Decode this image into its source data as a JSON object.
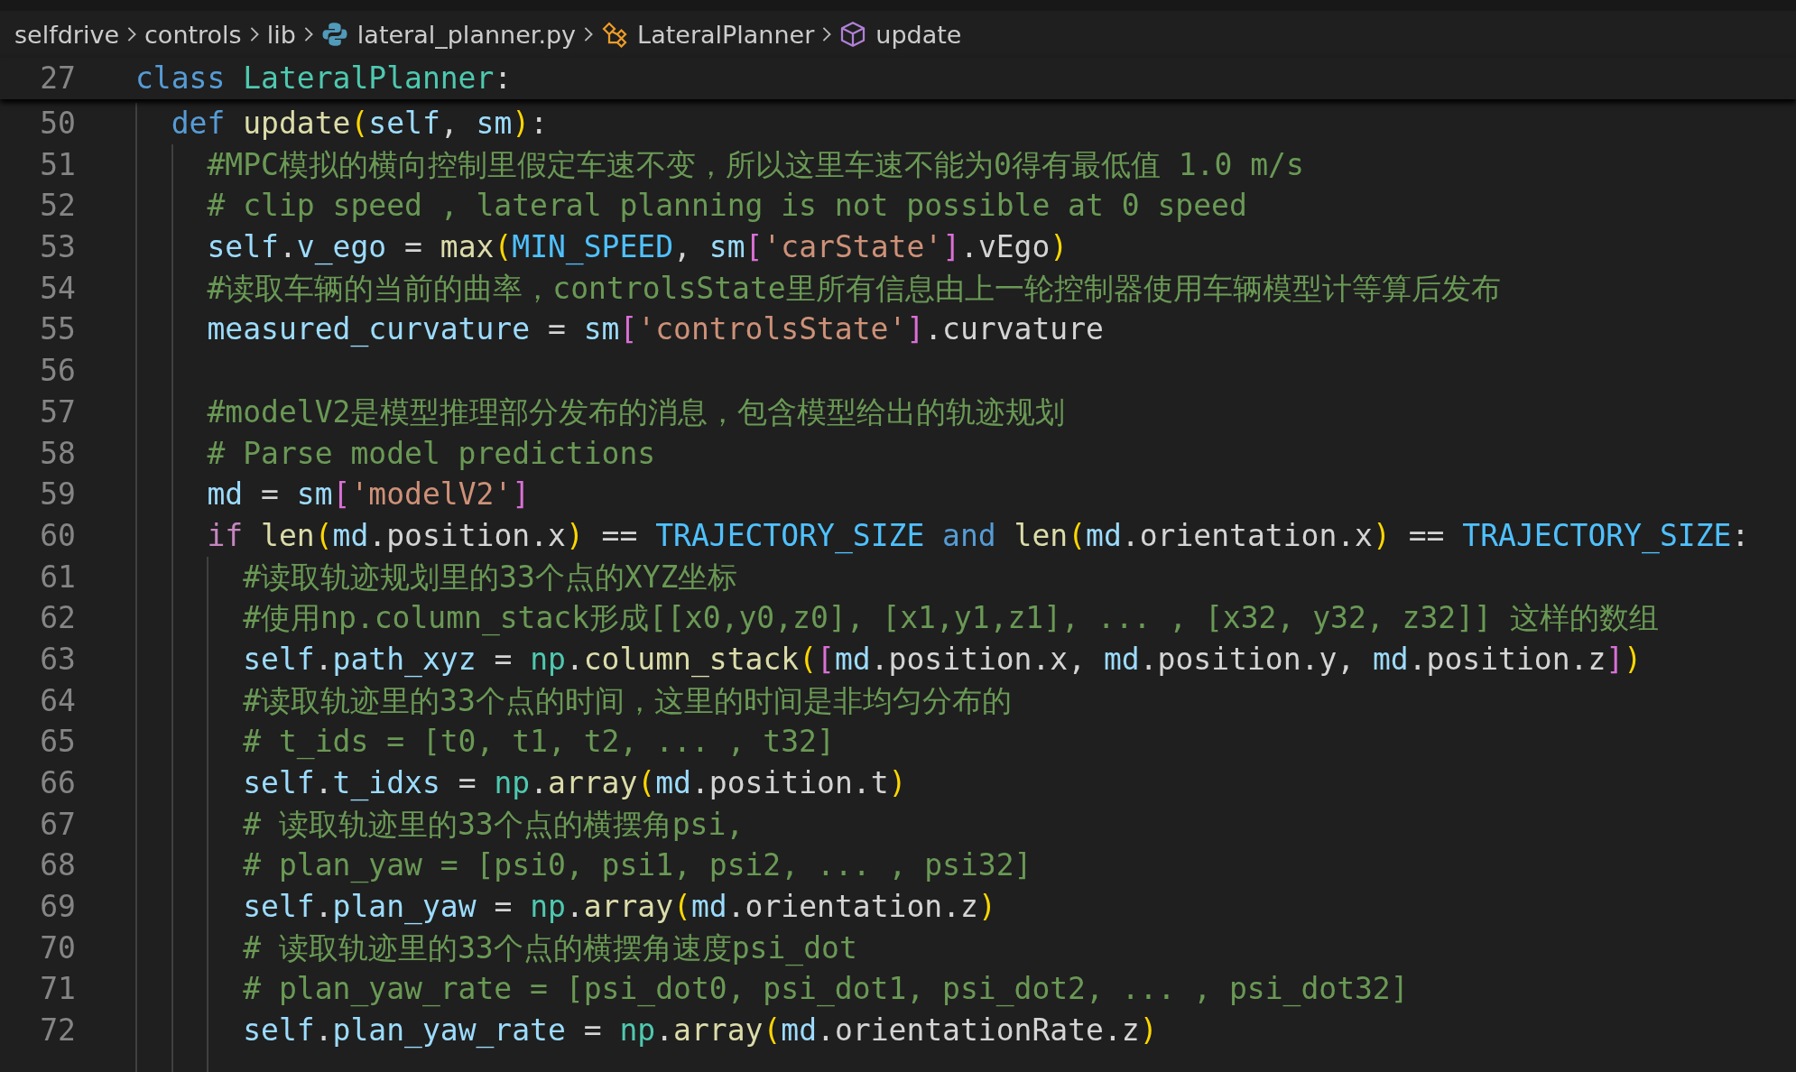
{
  "breadcrumbs": [
    {
      "label": "selfdrive",
      "kind": "folder"
    },
    {
      "label": "controls",
      "kind": "folder"
    },
    {
      "label": "lib",
      "kind": "folder"
    },
    {
      "label": "lateral_planner.py",
      "kind": "python-file"
    },
    {
      "label": "LateralPlanner",
      "kind": "class"
    },
    {
      "label": "update",
      "kind": "method"
    }
  ],
  "sticky_line": {
    "num": "27",
    "tokens": [
      {
        "text": "class",
        "kind": "kw"
      },
      {
        "text": " LateralPlanner",
        "kind": "cls"
      },
      {
        "text": ":",
        "kind": "p"
      }
    ]
  },
  "lines": [
    {
      "num": "50",
      "tokens": [
        {
          "text": "  def",
          "kind": "kw"
        },
        {
          "text": " update",
          "kind": "fn"
        },
        {
          "text": "(",
          "kind": "b1"
        },
        {
          "text": "self",
          "kind": "var"
        },
        {
          "text": ", ",
          "kind": "p"
        },
        {
          "text": "sm",
          "kind": "var"
        },
        {
          "text": ")",
          "kind": "b1"
        },
        {
          "text": ":",
          "kind": "p"
        }
      ]
    },
    {
      "num": "51",
      "tokens": [
        {
          "text": "    #MPC模拟的横向控制里假定车速不变，所以这里车速不能为0得有最低值 1.0 m/s",
          "kind": "cm"
        }
      ]
    },
    {
      "num": "52",
      "tokens": [
        {
          "text": "    # clip speed , lateral planning is not possible at 0 speed",
          "kind": "cm"
        }
      ]
    },
    {
      "num": "53",
      "tokens": [
        {
          "text": "    self",
          "kind": "var"
        },
        {
          "text": ".",
          "kind": "p"
        },
        {
          "text": "v_ego",
          "kind": "var"
        },
        {
          "text": " = ",
          "kind": "p"
        },
        {
          "text": "max",
          "kind": "fn"
        },
        {
          "text": "(",
          "kind": "b1"
        },
        {
          "text": "MIN_SPEED",
          "kind": "const"
        },
        {
          "text": ", ",
          "kind": "p"
        },
        {
          "text": "sm",
          "kind": "var"
        },
        {
          "text": "[",
          "kind": "b2"
        },
        {
          "text": "'carState'",
          "kind": "str"
        },
        {
          "text": "]",
          "kind": "b2"
        },
        {
          "text": ".vEgo",
          "kind": "p"
        },
        {
          "text": ")",
          "kind": "b1"
        }
      ]
    },
    {
      "num": "54",
      "tokens": [
        {
          "text": "    #读取车辆的当前的曲率，controlsState里所有信息由上一轮控制器使用车辆模型计等算后发布",
          "kind": "cm"
        }
      ]
    },
    {
      "num": "55",
      "tokens": [
        {
          "text": "    measured_curvature",
          "kind": "var"
        },
        {
          "text": " = ",
          "kind": "p"
        },
        {
          "text": "sm",
          "kind": "var"
        },
        {
          "text": "[",
          "kind": "b2"
        },
        {
          "text": "'controlsState'",
          "kind": "str"
        },
        {
          "text": "]",
          "kind": "b2"
        },
        {
          "text": ".curvature",
          "kind": "p"
        }
      ]
    },
    {
      "num": "56"
    },
    {
      "num": "57",
      "tokens": [
        {
          "text": "    #modelV2是模型推理部分发布的消息，包含模型给出的轨迹规划",
          "kind": "cm"
        }
      ]
    },
    {
      "num": "58",
      "tokens": [
        {
          "text": "    # Parse model predictions",
          "kind": "cm"
        }
      ]
    },
    {
      "num": "59",
      "tokens": [
        {
          "text": "    md",
          "kind": "var"
        },
        {
          "text": " = ",
          "kind": "p"
        },
        {
          "text": "sm",
          "kind": "var"
        },
        {
          "text": "[",
          "kind": "b2"
        },
        {
          "text": "'modelV2'",
          "kind": "str"
        },
        {
          "text": "]",
          "kind": "b2"
        }
      ]
    },
    {
      "num": "60",
      "tokens": [
        {
          "text": "    if",
          "kind": "kw2"
        },
        {
          "text": " len",
          "kind": "fn"
        },
        {
          "text": "(",
          "kind": "b1"
        },
        {
          "text": "md",
          "kind": "var"
        },
        {
          "text": ".position.x",
          "kind": "p"
        },
        {
          "text": ")",
          "kind": "b1"
        },
        {
          "text": " == ",
          "kind": "p"
        },
        {
          "text": "TRAJECTORY_SIZE",
          "kind": "const"
        },
        {
          "text": " and",
          "kind": "kw"
        },
        {
          "text": " len",
          "kind": "fn"
        },
        {
          "text": "(",
          "kind": "b1"
        },
        {
          "text": "md",
          "kind": "var"
        },
        {
          "text": ".orientation.x",
          "kind": "p"
        },
        {
          "text": ")",
          "kind": "b1"
        },
        {
          "text": " == ",
          "kind": "p"
        },
        {
          "text": "TRAJECTORY_SIZE",
          "kind": "const"
        },
        {
          "text": ":",
          "kind": "p"
        }
      ]
    },
    {
      "num": "61",
      "tokens": [
        {
          "text": "      #读取轨迹规划里的33个点的XYZ坐标",
          "kind": "cm"
        }
      ]
    },
    {
      "num": "62",
      "tokens": [
        {
          "text": "      #使用np.column_stack形成[[x0,y0,z0], [x1,y1,z1], ... , [x32, y32, z32]] 这样的数组",
          "kind": "cm"
        }
      ]
    },
    {
      "num": "63",
      "tokens": [
        {
          "text": "      self",
          "kind": "var"
        },
        {
          "text": ".",
          "kind": "p"
        },
        {
          "text": "path_xyz",
          "kind": "var"
        },
        {
          "text": " = ",
          "kind": "p"
        },
        {
          "text": "np",
          "kind": "cls"
        },
        {
          "text": ".",
          "kind": "p"
        },
        {
          "text": "column_stack",
          "kind": "fn"
        },
        {
          "text": "(",
          "kind": "b1"
        },
        {
          "text": "[",
          "kind": "b2"
        },
        {
          "text": "md",
          "kind": "var"
        },
        {
          "text": ".position.x, ",
          "kind": "p"
        },
        {
          "text": "md",
          "kind": "var"
        },
        {
          "text": ".position.y, ",
          "kind": "p"
        },
        {
          "text": "md",
          "kind": "var"
        },
        {
          "text": ".position.z",
          "kind": "p"
        },
        {
          "text": "]",
          "kind": "b2"
        },
        {
          "text": ")",
          "kind": "b1"
        }
      ]
    },
    {
      "num": "64",
      "tokens": [
        {
          "text": "      #读取轨迹里的33个点的时间，这里的时间是非均匀分布的",
          "kind": "cm"
        }
      ]
    },
    {
      "num": "65",
      "tokens": [
        {
          "text": "      # t_ids = [t0, t1, t2, ... , t32]",
          "kind": "cm"
        }
      ]
    },
    {
      "num": "66",
      "tokens": [
        {
          "text": "      self",
          "kind": "var"
        },
        {
          "text": ".",
          "kind": "p"
        },
        {
          "text": "t_idxs",
          "kind": "var"
        },
        {
          "text": " = ",
          "kind": "p"
        },
        {
          "text": "np",
          "kind": "cls"
        },
        {
          "text": ".",
          "kind": "p"
        },
        {
          "text": "array",
          "kind": "fn"
        },
        {
          "text": "(",
          "kind": "b1"
        },
        {
          "text": "md",
          "kind": "var"
        },
        {
          "text": ".position.t",
          "kind": "p"
        },
        {
          "text": ")",
          "kind": "b1"
        }
      ]
    },
    {
      "num": "67",
      "tokens": [
        {
          "text": "      # 读取轨迹里的33个点的横摆角psi,",
          "kind": "cm"
        }
      ]
    },
    {
      "num": "68",
      "tokens": [
        {
          "text": "      # plan_yaw = [psi0, psi1, psi2, ... , psi32]",
          "kind": "cm"
        }
      ]
    },
    {
      "num": "69",
      "tokens": [
        {
          "text": "      self",
          "kind": "var"
        },
        {
          "text": ".",
          "kind": "p"
        },
        {
          "text": "plan_yaw",
          "kind": "var"
        },
        {
          "text": " = ",
          "kind": "p"
        },
        {
          "text": "np",
          "kind": "cls"
        },
        {
          "text": ".",
          "kind": "p"
        },
        {
          "text": "array",
          "kind": "fn"
        },
        {
          "text": "(",
          "kind": "b1"
        },
        {
          "text": "md",
          "kind": "var"
        },
        {
          "text": ".orientation.z",
          "kind": "p"
        },
        {
          "text": ")",
          "kind": "b1"
        }
      ]
    },
    {
      "num": "70",
      "tokens": [
        {
          "text": "      # 读取轨迹里的33个点的横摆角速度psi_dot",
          "kind": "cm"
        }
      ]
    },
    {
      "num": "71",
      "tokens": [
        {
          "text": "      # plan_yaw_rate = [psi_dot0, psi_dot1, psi_dot2, ... , psi_dot32]",
          "kind": "cm"
        }
      ]
    },
    {
      "num": "72",
      "tokens": [
        {
          "text": "      self",
          "kind": "var"
        },
        {
          "text": ".",
          "kind": "p"
        },
        {
          "text": "plan_yaw_rate",
          "kind": "var"
        },
        {
          "text": " = ",
          "kind": "p"
        },
        {
          "text": "np",
          "kind": "cls"
        },
        {
          "text": ".",
          "kind": "p"
        },
        {
          "text": "array",
          "kind": "fn"
        },
        {
          "text": "(",
          "kind": "b1"
        },
        {
          "text": "md",
          "kind": "var"
        },
        {
          "text": ".orientationRate.z",
          "kind": "p"
        },
        {
          "text": ")",
          "kind": "b1"
        }
      ]
    }
  ]
}
